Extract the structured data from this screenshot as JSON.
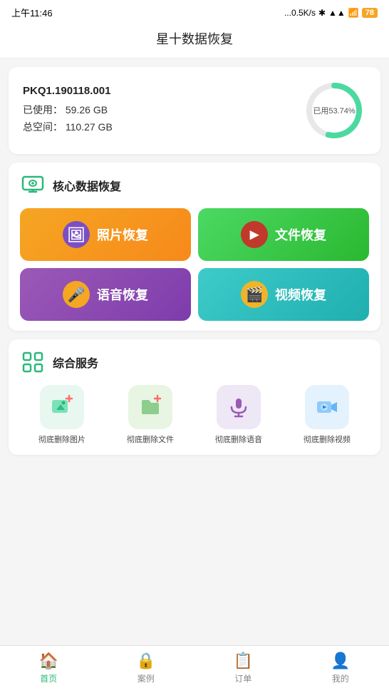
{
  "statusBar": {
    "time": "上午11:46",
    "network": "...0.5K/s",
    "battery": "78"
  },
  "pageTitle": "星十数据恢复",
  "storage": {
    "model": "PKQ1.190118.001",
    "usedLabel": "已使用：",
    "usedValue": "59.26 GB",
    "totalLabel": "总空间：",
    "totalValue": "110.27 GB",
    "percentLabel": "已用53.74%",
    "percentValue": 53.74
  },
  "coreRecovery": {
    "sectionTitle": "核心数据恢复",
    "buttons": [
      {
        "label": "照片恢复",
        "colorClass": "btn-orange",
        "iconClass": "icon-bg-purple",
        "icon": "🖼"
      },
      {
        "label": "文件恢复",
        "colorClass": "btn-green",
        "iconClass": "icon-bg-pink",
        "icon": "▶"
      },
      {
        "label": "语音恢复",
        "colorClass": "btn-purple",
        "iconClass": "icon-bg-orange",
        "icon": "🎤"
      },
      {
        "label": "视频恢复",
        "colorClass": "btn-cyan",
        "iconClass": "icon-bg-gold",
        "icon": "🎬"
      }
    ]
  },
  "services": {
    "sectionTitle": "综合服务",
    "items": [
      {
        "label": "彻底删除图片",
        "icon": "🖼",
        "bgClass": "svc-green"
      },
      {
        "label": "彻底删除文件",
        "icon": "📁",
        "bgClass": "svc-lime"
      },
      {
        "label": "彻底删除语音",
        "icon": "🎙",
        "bgClass": "svc-purple"
      },
      {
        "label": "彻底删除视频",
        "icon": "▶",
        "bgClass": "svc-blue"
      }
    ]
  },
  "bottomNav": [
    {
      "icon": "🏠",
      "label": "首页",
      "active": true
    },
    {
      "icon": "🔒",
      "label": "案例",
      "active": false
    },
    {
      "icon": "📋",
      "label": "订单",
      "active": false
    },
    {
      "icon": "👤",
      "label": "我的",
      "active": false
    }
  ]
}
